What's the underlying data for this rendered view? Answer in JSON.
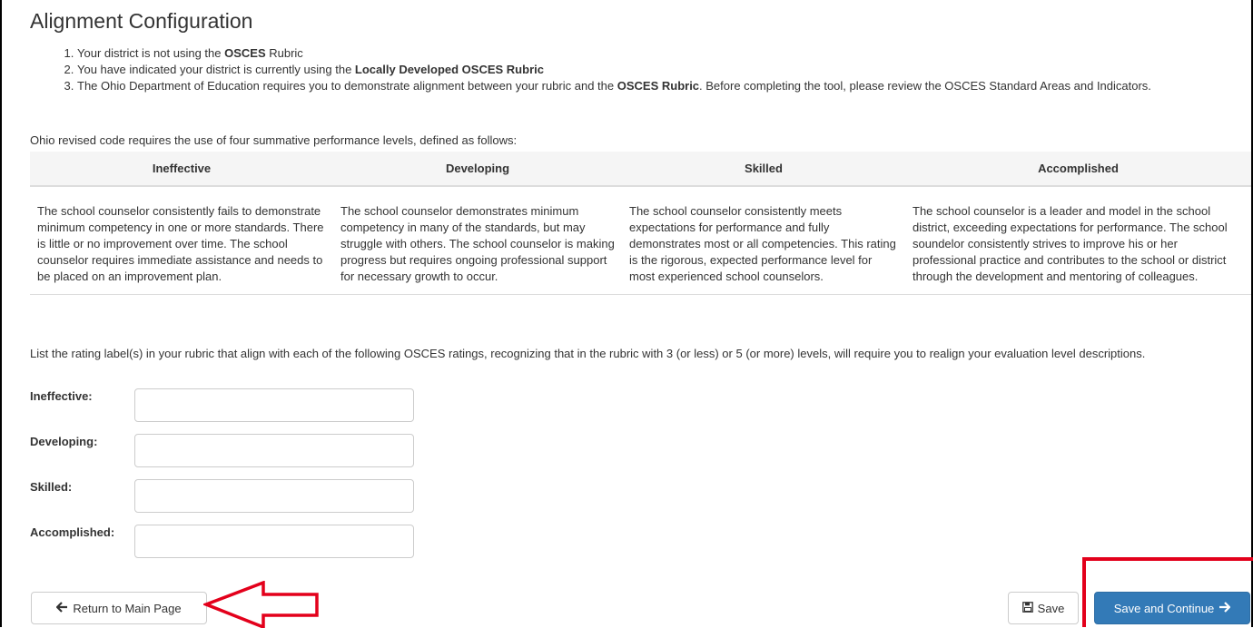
{
  "page": {
    "title": "Alignment Configuration"
  },
  "steps": [
    {
      "before": "Your district is not using the ",
      "bold": "OSCES",
      "after": " Rubric"
    },
    {
      "before": "You have indicated your district is currently using the ",
      "bold": "Locally Developed OSCES Rubric",
      "after": ""
    },
    {
      "before": "The Ohio Department of Education requires you to demonstrate alignment between your rubric and the ",
      "bold": "OSCES Rubric",
      "after": ". Before completing the tool, please review the OSCES Standard Areas and Indicators."
    }
  ],
  "intro": "Ohio revised code requires the use of four summative performance levels, defined as follows:",
  "levels": {
    "headers": [
      "Ineffective",
      "Developing",
      "Skilled",
      "Accomplished"
    ],
    "descriptions": [
      "The school counselor consistently fails to demonstrate minimum competency in one or more standards. There is little or no improvement over time. The school counselor requires immediate assistance and needs to be placed on an improvement plan.",
      "The school counselor demonstrates minimum competency in many of the standards, but may struggle with others. The school counselor is making progress but requires ongoing professional support for necessary growth to occur.",
      "The school counselor consistently meets expectations for performance and fully demonstrates most or all competencies. This rating is the rigorous, expected performance level for most experienced school counselors.",
      "The school counselor is a leader and model in the school district, exceeding expectations for performance. The school soundelor consistently strives to improve his or her professional practice and contributes to the school or district through the development and mentoring of colleagues."
    ]
  },
  "instructions": "List the rating label(s) in your rubric that align with each of the following OSCES ratings, recognizing that in the rubric with 3 (or less) or 5 (or more) levels, will require you to realign your evaluation level descriptions.",
  "fields": [
    {
      "label": "Ineffective:",
      "value": ""
    },
    {
      "label": "Developing:",
      "value": ""
    },
    {
      "label": "Skilled:",
      "value": ""
    },
    {
      "label": "Accomplished:",
      "value": ""
    }
  ],
  "buttons": {
    "return_label": "Return to Main Page",
    "save_label": "Save",
    "save_continue_label": "Save and Continue"
  },
  "icons": {
    "return": "arrow-left-icon",
    "save": "floppy-disk-icon",
    "continue": "arrow-right-icon"
  },
  "colors": {
    "primary": "#337ab7",
    "annotation": "#e3001b",
    "header_bg": "#f5f5f5"
  }
}
